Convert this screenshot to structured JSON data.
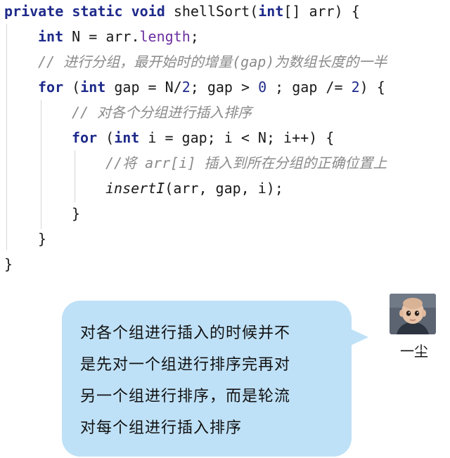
{
  "code": {
    "lines": [
      {
        "parts": [
          {
            "t": "private static void",
            "c": "kw"
          },
          {
            "t": " shellSort(",
            "c": ""
          },
          {
            "t": "int",
            "c": "kw"
          },
          {
            "t": "[] arr) {",
            "c": ""
          }
        ]
      },
      {
        "parts": [
          {
            "t": "int",
            "c": "kw"
          },
          {
            "t": " N = arr.",
            "c": ""
          },
          {
            "t": "length",
            "c": "field"
          },
          {
            "t": ";",
            "c": ""
          }
        ]
      },
      {
        "parts": [
          {
            "t": "// 进行分组，最开始时的增量(gap)为数组长度的一半",
            "c": "cm"
          }
        ]
      },
      {
        "parts": [
          {
            "t": "for",
            "c": "kw"
          },
          {
            "t": " (",
            "c": ""
          },
          {
            "t": "int",
            "c": "kw"
          },
          {
            "t": " gap = N/",
            "c": ""
          },
          {
            "t": "2",
            "c": "num"
          },
          {
            "t": "; gap > ",
            "c": ""
          },
          {
            "t": "0",
            "c": "num"
          },
          {
            "t": " ; gap /= ",
            "c": ""
          },
          {
            "t": "2",
            "c": "num"
          },
          {
            "t": ") {",
            "c": ""
          }
        ]
      },
      {
        "parts": [
          {
            "t": "// 对各个分组进行插入排序",
            "c": "cm"
          }
        ]
      },
      {
        "parts": [
          {
            "t": "for",
            "c": "kw"
          },
          {
            "t": " (",
            "c": ""
          },
          {
            "t": "int",
            "c": "kw"
          },
          {
            "t": " i = gap; i < N; i++) {",
            "c": ""
          }
        ]
      },
      {
        "parts": [
          {
            "t": "//将 arr[i] 插入到所在分组的正确位置上",
            "c": "cm"
          }
        ]
      },
      {
        "parts": [
          {
            "t": "insertI",
            "c": "fn"
          },
          {
            "t": "(arr, gap, i);",
            "c": ""
          }
        ]
      },
      {
        "parts": [
          {
            "t": "}",
            "c": ""
          }
        ]
      },
      {
        "parts": [
          {
            "t": "}",
            "c": ""
          }
        ]
      },
      {
        "parts": [
          {
            "t": "}",
            "c": ""
          }
        ]
      }
    ]
  },
  "bubble": {
    "lines": [
      "对各个组进行插入的时候并不",
      "是先对一个组进行排序完再对",
      "另一个组进行排序，而是轮流",
      "对每个组进行插入排序"
    ]
  },
  "avatar": {
    "name": "一尘"
  }
}
